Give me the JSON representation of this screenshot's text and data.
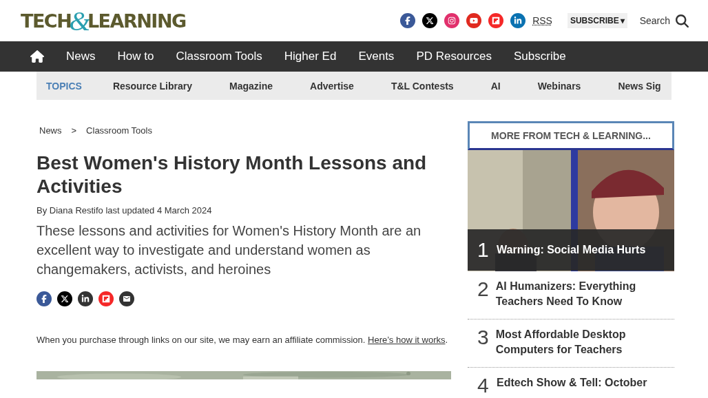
{
  "header": {
    "logo": {
      "part_1": "TECH",
      "ampersand": "&",
      "part_2": "LEARNING"
    },
    "rss": "RSS",
    "subscribe": "SUBSCRIBE",
    "subscribe_caret": "▾",
    "search": "Search"
  },
  "nav": {
    "items": [
      {
        "label": "News"
      },
      {
        "label": "How to"
      },
      {
        "label": "Classroom Tools"
      },
      {
        "label": "Higher Ed"
      },
      {
        "label": "Events"
      },
      {
        "label": "PD Resources"
      },
      {
        "label": "Subscribe"
      }
    ]
  },
  "topics": {
    "heading": "TOPICS",
    "items": [
      "Resource Library",
      "Magazine",
      "Advertise",
      "T&L Contests",
      "AI",
      "Webinars",
      "News Sig"
    ]
  },
  "breadcrumb": {
    "items": [
      "News",
      "Classroom Tools"
    ],
    "separator": ">"
  },
  "article": {
    "title": "Best Women's History Month Lessons and Activities",
    "byline": {
      "prefix": "By",
      "author": "Diana Restifo",
      "updated": "last updated 4 March 2024"
    },
    "standfirst": "These lessons and activities for Women's History Month are an excellent way to investigate and understand women as changemakers, activists, and heroines",
    "affiliate": {
      "text": "When you purchase through links on our site, we may earn an affiliate commission.",
      "link": "Here’s how it works",
      "end": "."
    }
  },
  "sidebar": {
    "heading": "MORE FROM TECH & LEARNING...",
    "items": [
      {
        "number": "1",
        "title": "Warning: Social Media Hurts",
        "kind": "featured"
      },
      {
        "number": "2",
        "title": "AI Humanizers: Everything Teachers Need To Know",
        "kind": "plain"
      },
      {
        "number": "3",
        "title": "Most Affordable Desktop Computers for Teachers",
        "kind": "plain"
      },
      {
        "number": "4",
        "title": "Edtech Show & Tell: October",
        "kind": "plain"
      }
    ]
  }
}
